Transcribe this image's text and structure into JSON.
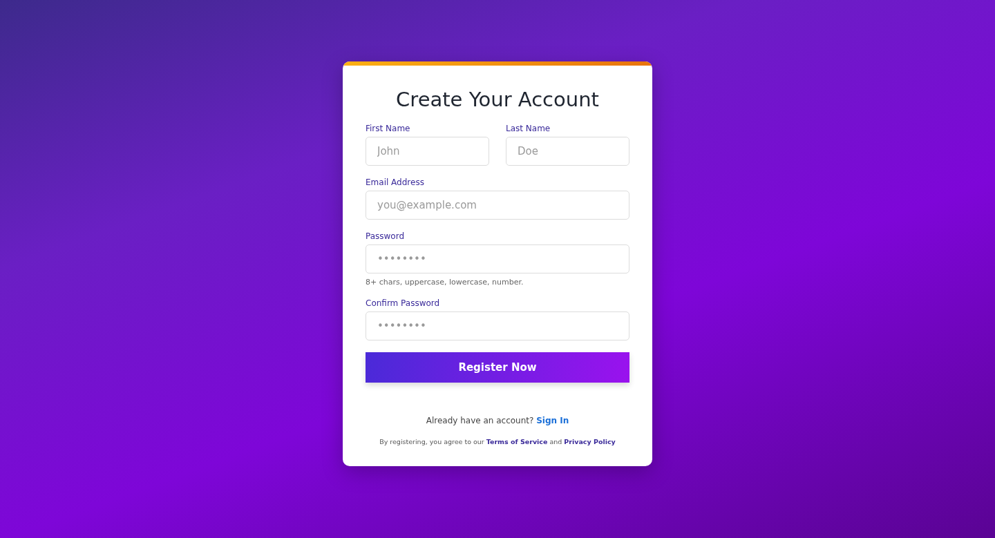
{
  "title": "Create Your Account",
  "name_fields": [
    {
      "label": "First Name",
      "placeholder": "John"
    },
    {
      "label": "Last Name",
      "placeholder": "Doe"
    }
  ],
  "fields": [
    {
      "label": "Email Address",
      "placeholder": "you@example.com"
    },
    {
      "label": "Password",
      "placeholder": "••••••••",
      "hint": "8+ chars, uppercase, lowercase, number."
    },
    {
      "label": "Confirm Password",
      "placeholder": "••••••••"
    }
  ],
  "submit_button": "Register Now",
  "signin_line": {
    "text": "Already have an account?",
    "link": "Sign In"
  },
  "terms_line": {
    "before": "By registering, you agree to our",
    "link_1": "Terms of Service",
    "between": "and",
    "link_2": "Privacy Policy"
  }
}
